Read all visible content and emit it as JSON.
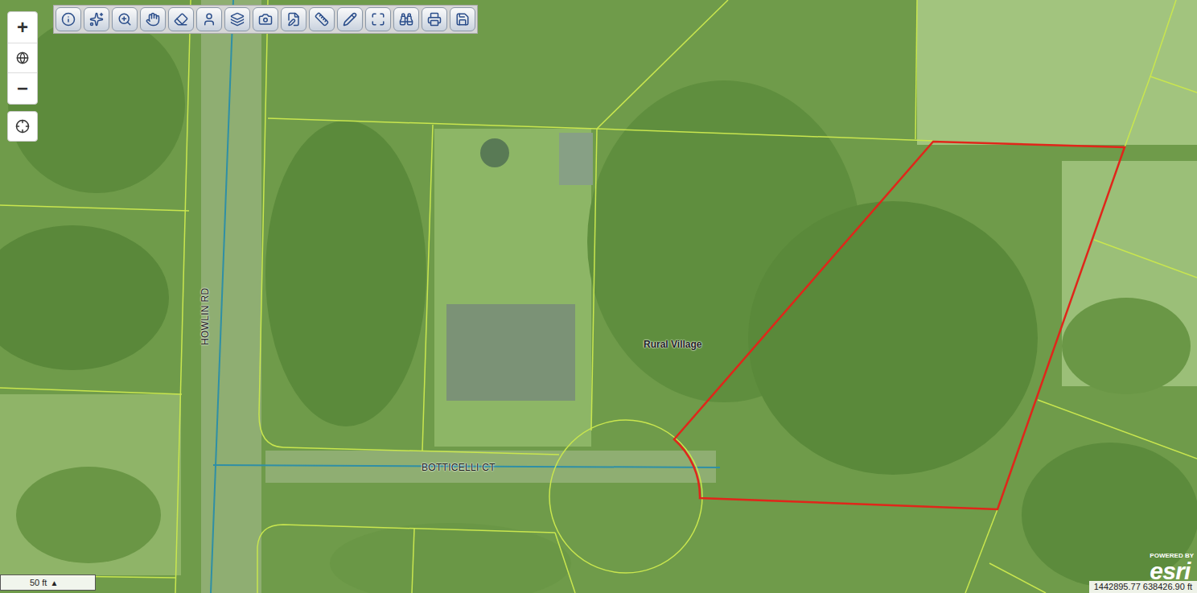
{
  "zoom": {
    "in": "+",
    "out": "−"
  },
  "roads": {
    "vertical": "HOWLIN RD",
    "horizontal": "BOTTICELLI CT"
  },
  "zone_label": "Rural Village",
  "parcel": {
    "selected": true
  },
  "scale_bar": {
    "label": "50 ft",
    "toggle": "▲"
  },
  "attribution": {
    "powered_by": "POWERED BY",
    "logo": "esri"
  },
  "coordinates": "1442895.77 638426.90 ft"
}
